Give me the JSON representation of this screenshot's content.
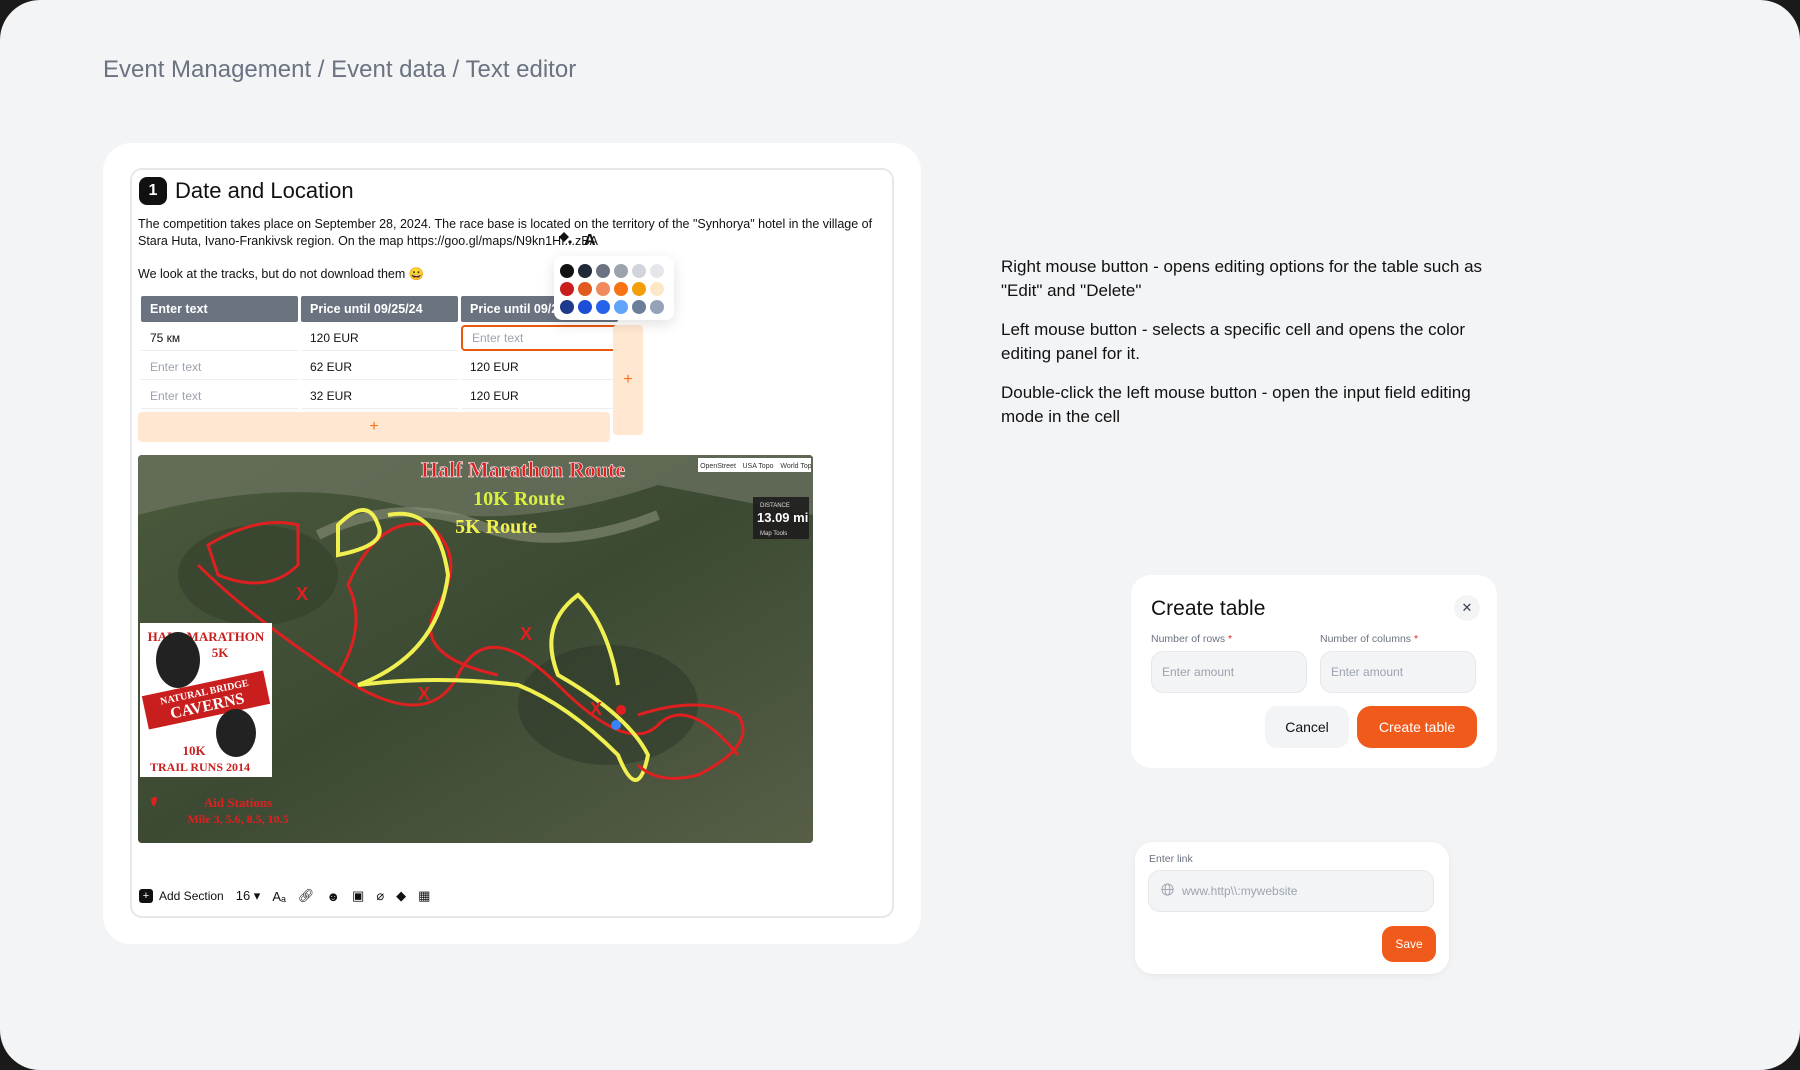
{
  "breadcrumb": {
    "items": [
      "Event Management",
      "Event data",
      "Text editor"
    ],
    "separator": " / "
  },
  "editor": {
    "section_number": "1",
    "section_title": "Date and Location",
    "paragraph1": "The competition takes place on September 28, 2024. The race base is located on the territory of the \"Synhorya\" hotel in the village of Stara Huta, Ivano-Frankivsk region. On the map https://goo.gl/maps/N9kn1HI...zBA",
    "paragraph2": "We look at the tracks, but do not download them 😀",
    "table": {
      "headers": [
        "Enter text",
        "Price until 09/25/24",
        "Price until 09/2"
      ],
      "rows": [
        [
          "75 км",
          "120 EUR",
          "Enter text"
        ],
        [
          "Enter text",
          "62 EUR",
          "120 EUR"
        ],
        [
          "Enter text",
          "32 EUR",
          "120 EUR"
        ]
      ],
      "add_row_label": "+",
      "add_col_label": "+"
    },
    "color_palette": {
      "fill_icon": "paint-bucket-icon",
      "text_icon": "text-color-icon",
      "text_icon_label": "A",
      "colors": [
        "#111111",
        "#1f2937",
        "#6b7280",
        "#9ca3af",
        "#d1d5db",
        "#e5e7eb",
        "#c81e1e",
        "#e05a1f",
        "#f08a5d",
        "#f97316",
        "#f59e0b",
        "#fde7c7",
        "#1e3a8a",
        "#1d4ed8",
        "#2563eb",
        "#60a5fa",
        "#6b7f9a",
        "#94a3b8"
      ]
    },
    "map": {
      "title": "Half Marathon Route",
      "route_10k": "10K Route",
      "route_5k": "5K Route",
      "distance_label": "DISTANCE",
      "distance_value": "13.09 mi",
      "map_tools": "Map Tools",
      "tabs": [
        "OpenStreet",
        "USA Topo",
        "World Top"
      ],
      "logo_lines": [
        "HALF MARATHON",
        "5K",
        "NATURAL BRIDGE",
        "CAVERNS",
        "10K",
        "TRAIL RUNS 2014"
      ],
      "aid_stations": "Aid Stations",
      "aid_miles": "Mile 3, 5.6, 8.5, 10.5"
    },
    "toolbar": {
      "add_section": "Add Section",
      "font_size": "16",
      "icons": [
        "font-size-icon",
        "link-icon",
        "emoji-icon",
        "image-icon",
        "attachment-icon",
        "fill-color-icon",
        "table-grid-icon"
      ]
    }
  },
  "instructions": {
    "right_click": "Right mouse button - opens editing options for the table such as \"Edit\" and \"Delete\"",
    "left_click": "Left mouse button - selects a specific cell and opens the color editing panel for it.",
    "double_click": "Double-click the left mouse button - open the input field editing mode in the cell"
  },
  "create_table": {
    "title": "Create table",
    "rows_label": "Number of rows",
    "cols_label": "Number of columns",
    "required_mark": "*",
    "rows_placeholder": "Enter amount",
    "cols_placeholder": "Enter amount",
    "cancel_label": "Cancel",
    "create_label": "Create table",
    "close_icon": "close-icon"
  },
  "link_dialog": {
    "label": "Enter link",
    "placeholder": "www.http\\\\:mywebsite",
    "save_label": "Save",
    "icon": "globe-icon"
  },
  "colors": {
    "accent": "#f05a1a",
    "table_header": "#6b7280",
    "add_area": "#ffe7d1"
  }
}
